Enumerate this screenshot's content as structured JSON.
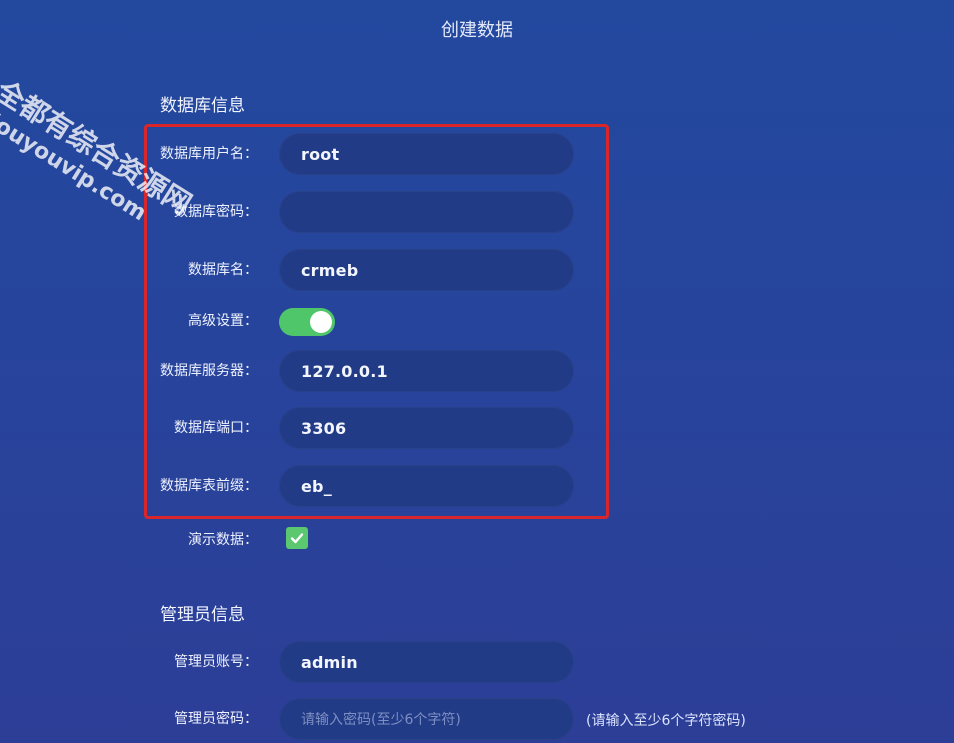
{
  "page": {
    "title": "创建数据"
  },
  "sections": {
    "database": "数据库信息",
    "admin": "管理员信息"
  },
  "db_fields": [
    {
      "label": "数据库用户名：",
      "value": "root"
    },
    {
      "label": "数据库密码：",
      "value": ""
    },
    {
      "label": "数据库名：",
      "value": "crmeb"
    },
    {
      "label": "高级设置：",
      "toggle_on": true
    },
    {
      "label": "数据库服务器：",
      "value": "127.0.0.1"
    },
    {
      "label": "数据库端口：",
      "value": "3306"
    },
    {
      "label": "数据库表前缀：",
      "value": "eb_"
    }
  ],
  "demo": {
    "label": "演示数据：",
    "checked": true
  },
  "admin_fields": [
    {
      "label": "管理员账号：",
      "value": "admin"
    },
    {
      "label": "管理员密码：",
      "placeholder": "请输入密码(至少6个字符)",
      "hint": "(请输入至少6个字符密码)"
    }
  ],
  "watermark": {
    "line1": "全都有综合资源网",
    "line2": "douyouvip.com"
  },
  "colors": {
    "highlight": "#d9262b",
    "toggle": "#4fc66a",
    "checkbox": "#5bc86f",
    "input_bg": "#223b86"
  },
  "icons": {
    "check": "checkmark-icon"
  }
}
